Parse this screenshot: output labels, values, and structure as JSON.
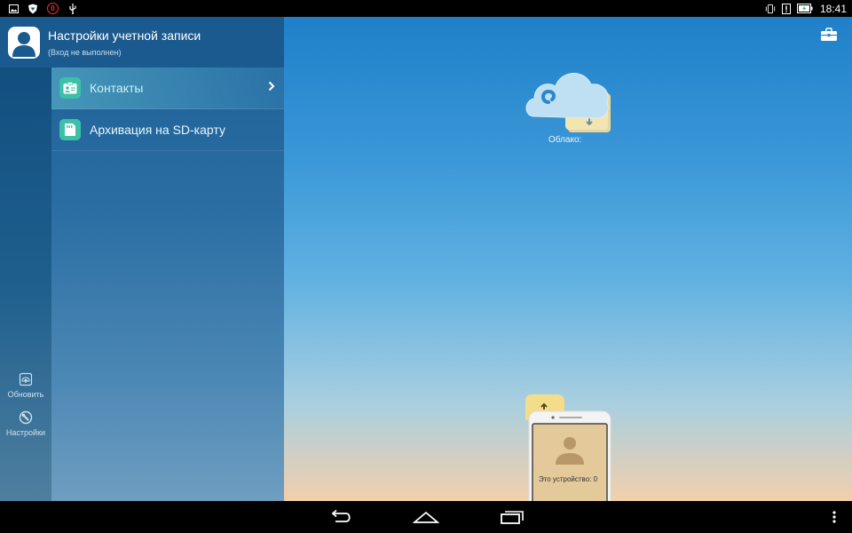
{
  "status_bar": {
    "notification_badge": "0",
    "time": "18:41",
    "icons": [
      "gallery-icon",
      "shield-icon",
      "usb-icon",
      "vibrate-icon",
      "alert-icon",
      "battery-icon"
    ]
  },
  "account": {
    "title": "Настройки учетной записи",
    "subtitle": "(Вход не выполнен)"
  },
  "menu": {
    "items": [
      {
        "label": "Контакты",
        "icon": "contacts-card-icon",
        "active": true
      },
      {
        "label": "Архивация на SD-карту",
        "icon": "sd-archive-icon",
        "active": false
      }
    ]
  },
  "rail": {
    "refresh_label": "Обновить",
    "settings_label": "Настройки"
  },
  "main": {
    "cloud_label": "Облако:",
    "device_label": "Это устройство: 0"
  },
  "colors": {
    "accent": "#3cc0a8",
    "header_bg": "#1b5a8e",
    "badge_red": "#e33"
  }
}
